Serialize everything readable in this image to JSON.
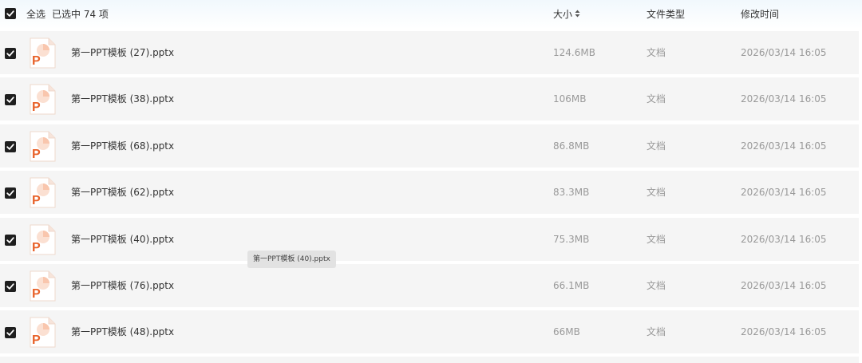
{
  "header": {
    "select_all_label": "全选",
    "selected_summary": "已选中 74 项",
    "col_size": "大小",
    "col_type": "文件类型",
    "col_mtime": "修改时间",
    "size_sort_icon": "sort-updown-icon"
  },
  "rows": [
    {
      "name": "第一PPT模板 (27).pptx",
      "size": "124.6MB",
      "type": "文档",
      "mtime": "2026/03/14 16:05",
      "checked": true,
      "icon": "pptx-file-icon"
    },
    {
      "name": "第一PPT模板 (38).pptx",
      "size": "106MB",
      "type": "文档",
      "mtime": "2026/03/14 16:05",
      "checked": true,
      "icon": "pptx-file-icon"
    },
    {
      "name": "第一PPT模板 (68).pptx",
      "size": "86.8MB",
      "type": "文档",
      "mtime": "2026/03/14 16:05",
      "checked": true,
      "icon": "pptx-file-icon"
    },
    {
      "name": "第一PPT模板 (62).pptx",
      "size": "83.3MB",
      "type": "文档",
      "mtime": "2026/03/14 16:05",
      "checked": true,
      "icon": "pptx-file-icon"
    },
    {
      "name": "第一PPT模板 (40).pptx",
      "size": "75.3MB",
      "type": "文档",
      "mtime": "2026/03/14 16:05",
      "checked": true,
      "icon": "pptx-file-icon"
    },
    {
      "name": "第一PPT模板 (76).pptx",
      "size": "66.1MB",
      "type": "文档",
      "mtime": "2026/03/14 16:05",
      "checked": true,
      "icon": "pptx-file-icon"
    },
    {
      "name": "第一PPT模板 (48).pptx",
      "size": "66MB",
      "type": "文档",
      "mtime": "2026/03/14 16:05",
      "checked": true,
      "icon": "pptx-file-icon"
    }
  ],
  "tooltip": {
    "text": "第一PPT模板 (40).pptx"
  },
  "colors": {
    "checkbox": "#1f1f1f",
    "row_bg": "#f5f5f5",
    "pptx_orange": "#e8622a",
    "pptx_light": "#f9c6ad"
  }
}
